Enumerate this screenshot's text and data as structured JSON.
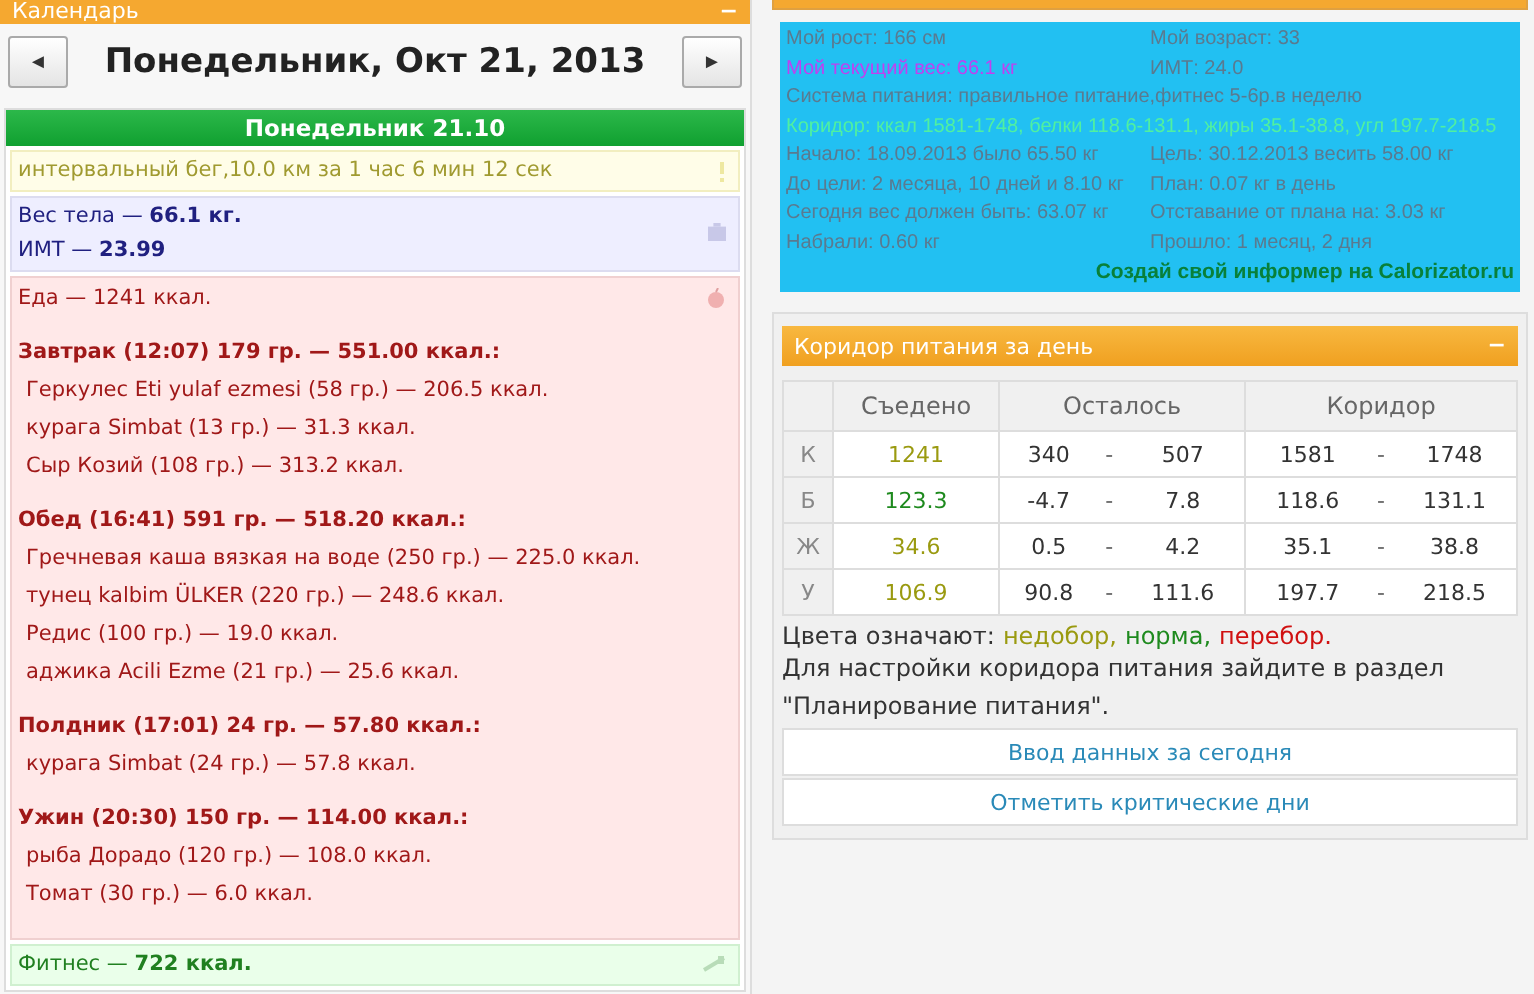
{
  "calendar": {
    "title": "Календарь",
    "collapse": "−",
    "date_title": "Понедельник, Окт 21, 2013",
    "prev": "◄",
    "next": "►",
    "day_header": "Понедельник 21.10",
    "entries": [
      {
        "kind": "exercise",
        "lines": [
          "интервальный бег,10.0 км за 1 час 6 мин 12 сек"
        ]
      },
      {
        "kind": "weight",
        "lines": [
          "Вес тела — **66.1 кг.**",
          "ИМТ — **23.99**"
        ]
      },
      {
        "kind": "food",
        "total": "Еда — 1241 ккал.",
        "meals": [
          {
            "title": "Завтрак (12:07) 179 гр. — 551.00 ккал.:",
            "items": [
              "Геркулес Eti yulaf ezmesi (58 гр.) — 206.5 ккал.",
              "курага Simbat (13 гр.) — 31.3 ккал.",
              "Сыр Козий (108 гр.) — 313.2 ккал."
            ]
          },
          {
            "title": "Обед (16:41) 591 гр. — 518.20 ккал.:",
            "items": [
              "Гречневая каша вязкая на воде (250 гр.) — 225.0 ккал.",
              "тунец kalbim ÜLKER (220 гр.) — 248.6 ккал.",
              "Редис (100 гр.) — 19.0 ккал.",
              "аджика Acili Ezme (21 гр.) — 25.6 ккал."
            ]
          },
          {
            "title": "Полдник (17:01) 24 гр. — 57.80 ккал.:",
            "items": [
              "курага Simbat (24 гр.) — 57.8 ккал."
            ]
          },
          {
            "title": "Ужин (20:30) 150 гр. — 114.00 ккал.:",
            "items": [
              "рыба Дорадо (120 гр.) — 108.0 ккал.",
              "Томат (30 гр.) — 6.0 ккал."
            ]
          }
        ]
      },
      {
        "kind": "fitness",
        "lines": [
          "Фитнес — **722 ккал.**"
        ]
      }
    ]
  },
  "informer": {
    "rows": [
      {
        "kind": "pair",
        "cells": [
          "Мой рост: 166 см",
          "Мой возраст: 33"
        ]
      },
      {
        "kind": "pair-accent",
        "cells": [
          "Мой текущий вес: 66.1 кг",
          "ИМТ: 24.0"
        ]
      },
      {
        "kind": "full",
        "cells": [
          "Система питания: правильное питание,фитнес 5-6р.в неделю"
        ]
      },
      {
        "kind": "corridor",
        "cells": [
          "Коридор: ккал 1581-1748, белки 118.6-131.1, жиры 35.1-38.8, угл 197.7-218.5"
        ]
      },
      {
        "kind": "pair",
        "cells": [
          "Начало: 18.09.2013 было 65.50 кг",
          "Цель: 30.12.2013 весить 58.00 кг"
        ]
      },
      {
        "kind": "pair",
        "cells": [
          "До цели: 2 месяца, 10 дней и 8.10 кг",
          "План: 0.07 кг в день"
        ]
      },
      {
        "kind": "pair",
        "cells": [
          "Сегодня вес должен быть: 63.07 кг",
          "Отставание от плана на: 3.03 кг"
        ]
      },
      {
        "kind": "pair",
        "cells": [
          "Набрали: 0.60 кг",
          "Прошло: 1 месяц, 2 дня"
        ]
      }
    ],
    "link": "Создай свой информер на Calorizator.ru"
  },
  "corridor": {
    "title": "Коридор питания за день",
    "collapse": "−",
    "columns": [
      "Съедено",
      "Осталось",
      "Коридор"
    ],
    "rows": [
      {
        "label": "К",
        "eaten": "1241",
        "color": "#9a9a10",
        "left_min": "340",
        "left_max": "507",
        "min": "1581",
        "max": "1748"
      },
      {
        "label": "Б",
        "eaten": "123.3",
        "color": "#1e8a1e",
        "left_min": "-4.7",
        "left_max": "7.8",
        "min": "118.6",
        "max": "131.1"
      },
      {
        "label": "Ж",
        "eaten": "34.6",
        "color": "#9a9a10",
        "left_min": "0.5",
        "left_max": "4.2",
        "min": "35.1",
        "max": "38.8"
      },
      {
        "label": "У",
        "eaten": "106.9",
        "color": "#9a9a10",
        "left_min": "90.8",
        "left_max": "111.6",
        "min": "197.7",
        "max": "218.5"
      }
    ],
    "dash": "-",
    "legend_label": "Цвета означают:",
    "legend": [
      {
        "text": "недобор,",
        "color": "#9a9a10"
      },
      {
        "text": "норма,",
        "color": "#1e8a1e"
      },
      {
        "text": "перебор.",
        "color": "#d01010"
      }
    ],
    "note": "Для настройки коридора питания зайдите в раздел \"Планирование питания\".",
    "buttons": [
      "Ввод данных за сегодня",
      "Отметить критические дни"
    ]
  }
}
